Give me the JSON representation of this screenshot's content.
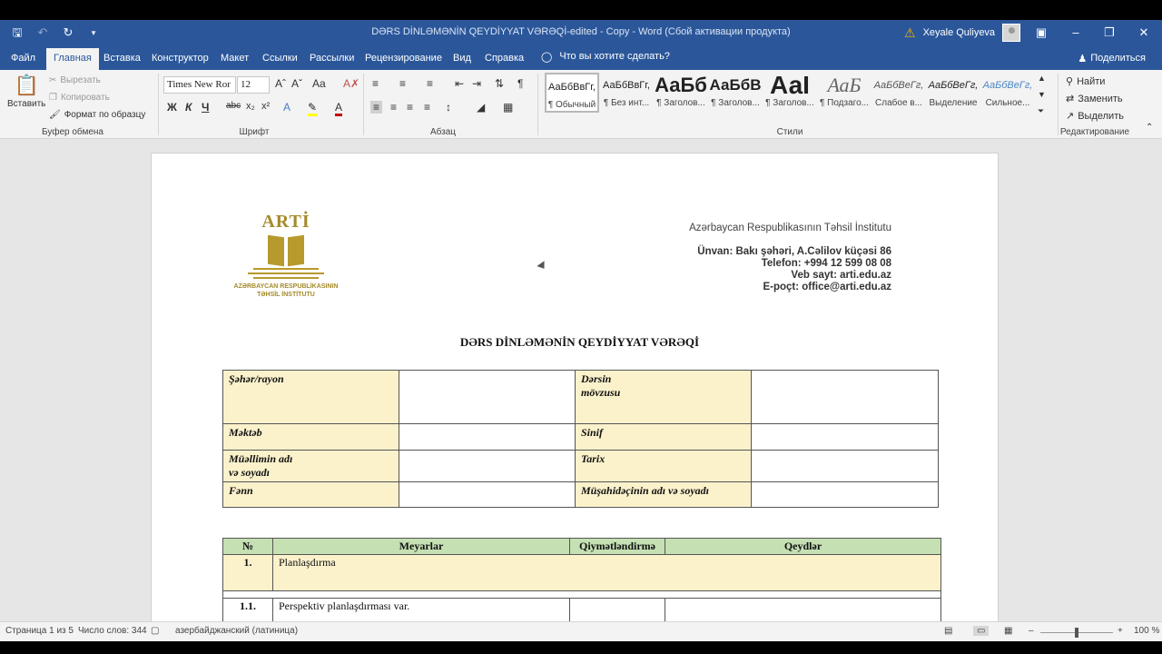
{
  "window": {
    "title": "DƏRS DİNLƏMƏNİN QEYDİYYAT VƏRƏQİ-edited - Copy  -  Word (Сбой активации продукта)",
    "user": "Xeyale Quliyeva"
  },
  "tabs": [
    "Файл",
    "Главная",
    "Вставка",
    "Конструктор",
    "Макет",
    "Ссылки",
    "Рассылки",
    "Рецензирование",
    "Вид",
    "Справка"
  ],
  "tell_me": "Что вы хотите сделать?",
  "share": "Поделиться",
  "ribbon": {
    "clipboard": {
      "paste": "Вставить",
      "cut": "Вырезать",
      "copy": "Копировать",
      "format_painter": "Формат по образцу",
      "label": "Буфер обмена"
    },
    "font": {
      "name": "Times New Ror",
      "size": "12",
      "label": "Шрифт"
    },
    "paragraph": {
      "label": "Абзац"
    },
    "styles": {
      "label": "Стили",
      "items": [
        {
          "preview": "АаБбВвГг,",
          "name": "¶ Обычный"
        },
        {
          "preview": "АаБбВвГг,",
          "name": "¶ Без инт..."
        },
        {
          "preview": "АаБб",
          "name": "¶ Заголов..."
        },
        {
          "preview": "АаБбВ",
          "name": "¶ Заголов..."
        },
        {
          "preview": "АаI",
          "name": "¶ Заголов..."
        },
        {
          "preview": "АаБ",
          "name": "¶ Подзаго..."
        },
        {
          "preview": "АаБбВеГг,",
          "name": "Слабое в..."
        },
        {
          "preview": "АаБбВеГг,",
          "name": "Выделение"
        },
        {
          "preview": "АаБбВеГг,",
          "name": "Сильное..."
        }
      ]
    },
    "editing": {
      "find": "Найти",
      "replace": "Заменить",
      "select": "Выделить",
      "label": "Редактирование"
    }
  },
  "document": {
    "logo": {
      "title": "ARTİ",
      "caption_line1": "AZƏRBAYCAN RESPUBLİKASININ",
      "caption_line2": "TƏHSİL İNSTİTUTU"
    },
    "org": {
      "name": "Azərbaycan Respublikasının Təhsil İnstitutu",
      "address": "Ünvan: Bakı şəhəri, A.Cəlilov küçəsi 86",
      "phone": "Telefon: +994 12 599 08 08",
      "site": "Veb sayt: arti.edu.az",
      "email": "E-poçt: office@arti.edu.az"
    },
    "heading": "DƏRS DİNLƏMƏNİN QEYDİYYAT VƏRƏQİ",
    "info_table": {
      "city": "Şəhər/rayon",
      "topic_1": "Dərsin",
      "topic_2": "mövzusu",
      "school": "Məktəb",
      "class": "Sinif",
      "teacher_1": "Müəllimin adı",
      "teacher_2": "və  soyadı",
      "date": "Tarix",
      "subject": "Fənn",
      "observer": "Müşahidəçinin adı və soyadı"
    },
    "criteria_table": {
      "headers": [
        "№",
        "Meyarlar",
        "Qiymətləndirmə",
        "Qeydlər"
      ],
      "rows": [
        {
          "num": "1.",
          "text": "Planlaşdırma"
        },
        {
          "num": "1.1.",
          "text": "Perspektiv planlaşdırması  var."
        }
      ]
    }
  },
  "status": {
    "page": "Страница 1 из 5",
    "words": "Число слов: 344",
    "language": "азербайджанский (латиница)",
    "zoom": "100 %"
  }
}
